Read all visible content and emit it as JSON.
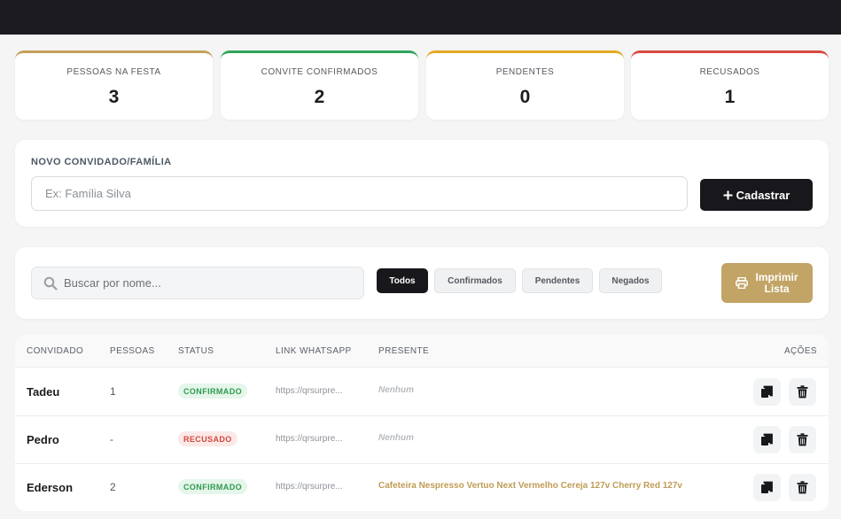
{
  "stats": [
    {
      "label": "PESSOAS NA FESTA",
      "value": "3",
      "color": "#c6a05a"
    },
    {
      "label": "CONVITE CONFIRMADOS",
      "value": "2",
      "color": "#2fa55a"
    },
    {
      "label": "PENDENTES",
      "value": "0",
      "color": "#e6a823"
    },
    {
      "label": "RECUSADOS",
      "value": "1",
      "color": "#d64b3f"
    }
  ],
  "new_guest": {
    "label": "NOVO CONVIDADO/FAMÍLIA",
    "placeholder": "Ex: Família Silva",
    "button_label": "Cadastrar",
    "button_icon": "plus-icon"
  },
  "filters": {
    "search_placeholder": "Buscar por nome...",
    "search_icon": "search-icon",
    "chips": [
      "Todos",
      "Confirmados",
      "Pendentes",
      "Negados"
    ],
    "active_chip": "Todos",
    "print_line1": "Imprimir",
    "print_line2": "Lista",
    "print_icon": "printer-icon"
  },
  "table": {
    "headers": {
      "guest": "CONVIDADO",
      "people": "PESSOAS",
      "status": "STATUS",
      "link": "LINK WHATSAPP",
      "gift": "PRESENTE",
      "actions": "AÇÕES"
    },
    "rows": [
      {
        "name": "Tadeu",
        "people": "1",
        "status": "CONFIRMADO",
        "status_kind": "ok",
        "link": "https://qrsurpre...",
        "gift": "Nenhum",
        "gift_kind": "none"
      },
      {
        "name": "Pedro",
        "people": "-",
        "status": "RECUSADO",
        "status_kind": "no",
        "link": "https://qrsurpre...",
        "gift": "Nenhum",
        "gift_kind": "none"
      },
      {
        "name": "Ederson",
        "people": "2",
        "status": "CONFIRMADO",
        "status_kind": "ok",
        "link": "https://qrsurpre...",
        "gift": "Cafeteira Nespresso Vertuo Next Vermelho Cereja 127v Cherry Red 127v",
        "gift_kind": "has"
      }
    ],
    "action_icons": [
      "copy-icon",
      "trash-icon"
    ]
  }
}
